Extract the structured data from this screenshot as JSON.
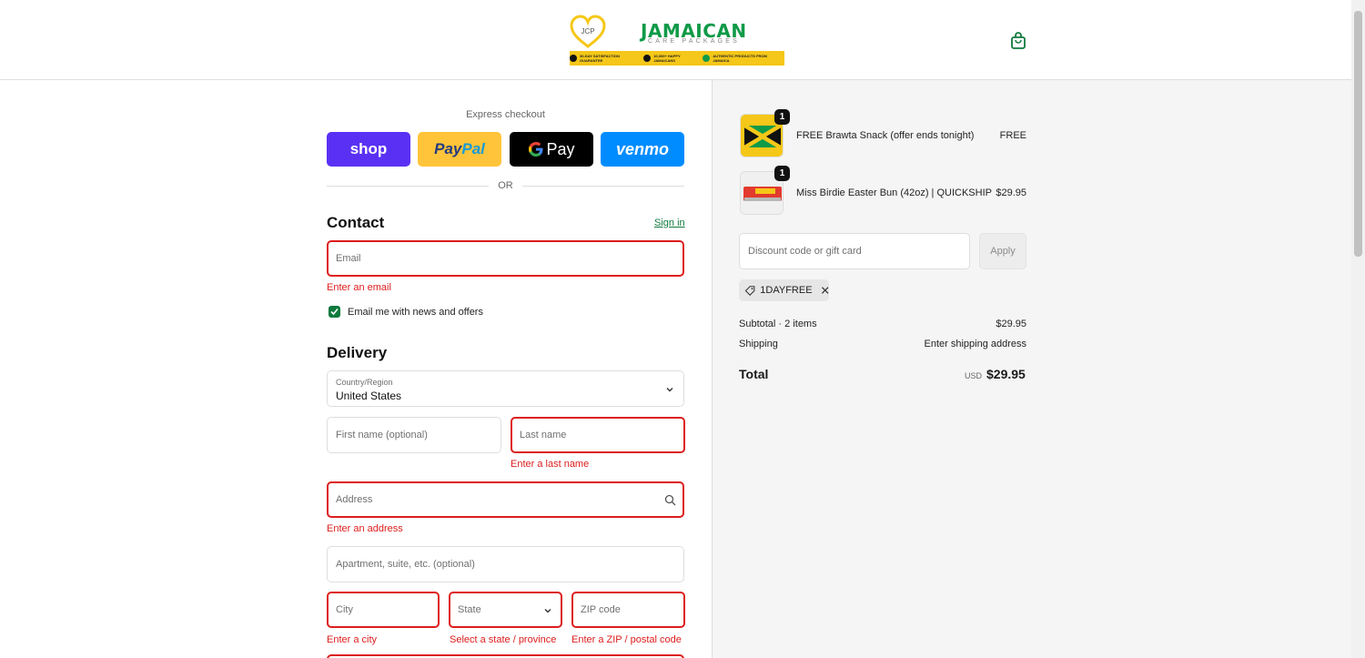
{
  "header": {
    "logo_initials": "JCP",
    "logo_title": "JAMAICAN",
    "logo_subtitle": "CARE PACKAGES",
    "strip_items": [
      "30-DAY SATISFACTION GUARANTEE",
      "10,000+ HAPPY JAMAICANS",
      "AUTHENTIC PRODUCTS FROM JAMAICA"
    ],
    "cart_icon": "shopping-bag-icon"
  },
  "express": {
    "label": "Express checkout",
    "buttons": {
      "shop": "shop",
      "paypal_1": "Pay",
      "paypal_2": "Pal",
      "gpay": "Pay",
      "venmo": "venmo"
    },
    "or": "OR"
  },
  "contact": {
    "title": "Contact",
    "signin": "Sign in",
    "email_placeholder": "Email",
    "email_error": "Enter an email",
    "newsletter_label": "Email me with news and offers",
    "newsletter_checked": true
  },
  "delivery": {
    "title": "Delivery",
    "country_label": "Country/Region",
    "country_value": "United States",
    "first_name_placeholder": "First name (optional)",
    "last_name_placeholder": "Last name",
    "last_name_error": "Enter a last name",
    "address_placeholder": "Address",
    "address_error": "Enter an address",
    "apartment_placeholder": "Apartment, suite, etc. (optional)",
    "city_placeholder": "City",
    "city_error": "Enter a city",
    "state_placeholder": "State",
    "state_error": "Select a state / province",
    "zip_placeholder": "ZIP code",
    "zip_error": "Enter a ZIP / postal code"
  },
  "summary": {
    "items": [
      {
        "name": "FREE Brawta Snack (offer ends tonight)",
        "price": "FREE",
        "qty": "1"
      },
      {
        "name": "Miss Birdie Easter Bun (42oz) | QUICKSHIP",
        "price": "$29.95",
        "qty": "1"
      }
    ],
    "discount_placeholder": "Discount code or gift card",
    "apply_label": "Apply",
    "applied_code": "1DAYFREE",
    "subtotal_label": "Subtotal · 2 items",
    "subtotal_value": "$29.95",
    "shipping_label": "Shipping",
    "shipping_value": "Enter shipping address",
    "total_label": "Total",
    "total_currency": "USD",
    "total_value": "$29.95"
  },
  "colors": {
    "accent": "#0f7a3e",
    "error": "#dd1d1d",
    "shop": "#5a31f4",
    "paypal": "#ffc439",
    "venmo": "#008cff"
  }
}
